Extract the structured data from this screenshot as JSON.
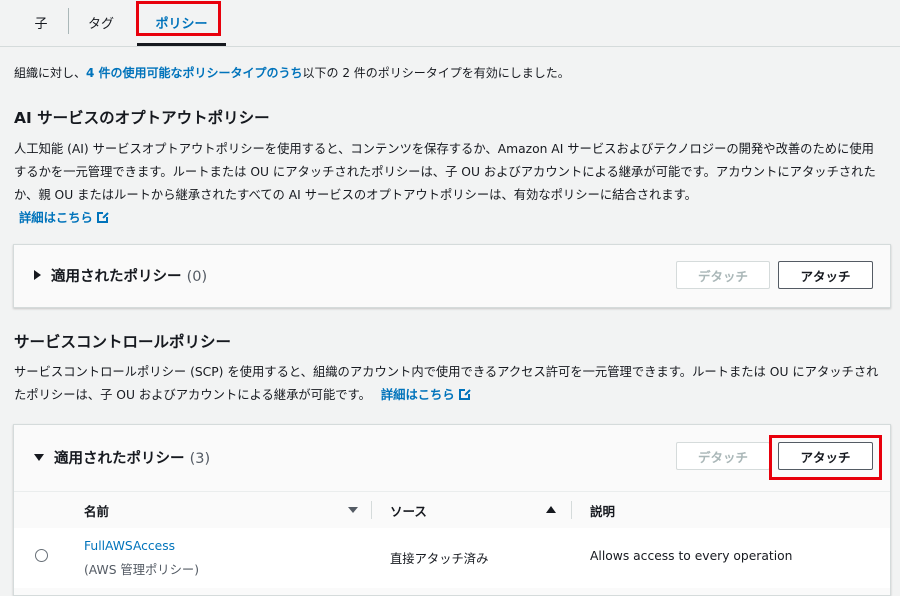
{
  "tabs": [
    {
      "label": "子"
    },
    {
      "label": "タグ"
    },
    {
      "label": "ポリシー"
    }
  ],
  "intro": {
    "prefix": "組織に対し、",
    "link": "4 件の使用可能なポリシータイプのうち",
    "suffix": "以下の 2 件のポリシータイプを有効にしました。"
  },
  "ai_section": {
    "title": "AI サービスのオプトアウトポリシー",
    "description": "人工知能 (AI) サービスオプトアウトポリシーを使用すると、コンテンツを保存するか、Amazon AI サービスおよびテクノロジーの開発や改善のために使用するかを一元管理できます。ルートまたは OU にアタッチされたポリシーは、子 OU およびアカウントによる継承が可能です。アカウントにアタッチされたか、親 OU またはルートから継承されたすべての AI サービスのオプトアウトポリシーは、有効なポリシーに結合されます。",
    "learn_more": "詳細はこちら",
    "panel": {
      "title": "適用されたポリシー",
      "count": "(0)",
      "detach_label": "デタッチ",
      "attach_label": "アタッチ"
    }
  },
  "scp_section": {
    "title": "サービスコントロールポリシー",
    "description": "サービスコントロールポリシー (SCP) を使用すると、組織のアカウント内で使用できるアクセス許可を一元管理できます。ルートまたは OU にアタッチされたポリシーは、子 OU およびアカウントによる継承が可能です。",
    "learn_more": "詳細はこちら",
    "panel": {
      "title": "適用されたポリシー",
      "count": "(3)",
      "detach_label": "デタッチ",
      "attach_label": "アタッチ",
      "columns": [
        "名前",
        "ソース",
        "説明"
      ],
      "rows": [
        {
          "name": "FullAWSAccess",
          "name_sub": "(AWS 管理ポリシー)",
          "source": "直接アタッチ済み",
          "description": "Allows access to every operation"
        }
      ]
    }
  },
  "colors": {
    "link": "#0073bb",
    "highlight": "#e8000c",
    "background": "#f2f3f3"
  }
}
